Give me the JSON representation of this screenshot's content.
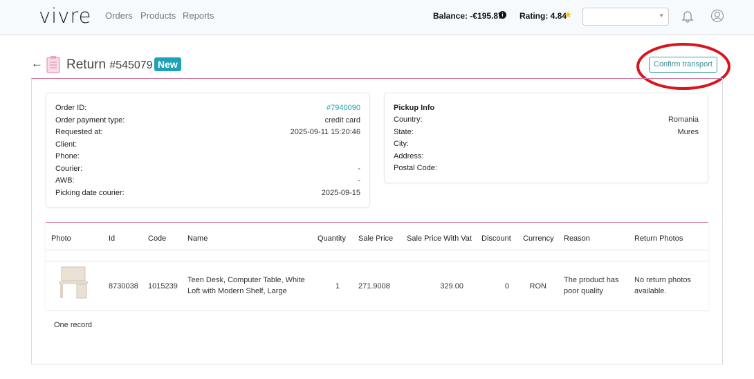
{
  "nav": {
    "logo": "vivre",
    "links": [
      "Orders",
      "Products",
      "Reports"
    ],
    "balance": "Balance: -€195.87",
    "rating": "Rating: 4.84",
    "select_value": ""
  },
  "header": {
    "title": "Return",
    "number": "#545079",
    "status": "New",
    "confirm_label": "Confirm transport"
  },
  "order": {
    "rows": [
      {
        "label": "Order ID:",
        "value": "#7940090"
      },
      {
        "label": "Order payment type:",
        "value": "credit card"
      },
      {
        "label": "Requested at:",
        "value": "2025-09-11 15:20:46"
      },
      {
        "label": "Client:",
        "value": ""
      },
      {
        "label": "Phone:",
        "value": ""
      },
      {
        "label": "Courier:",
        "value": "-"
      },
      {
        "label": "AWB:",
        "value": "-"
      },
      {
        "label": "Picking date courier:",
        "value": "2025-09-15"
      }
    ]
  },
  "pickup": {
    "title": "Pickup Info",
    "rows": [
      {
        "label": "Country:",
        "value": "Romania"
      },
      {
        "label": "State:",
        "value": "Mures"
      },
      {
        "label": "City:",
        "value": ""
      },
      {
        "label": "Address:",
        "value": ""
      },
      {
        "label": "Postal Code:",
        "value": ""
      }
    ]
  },
  "table": {
    "headers": [
      "Photo",
      "Id",
      "Code",
      "Name",
      "Quantity",
      "Sale Price",
      "Sale Price With Vat",
      "Discount",
      "Currency",
      "Reason",
      "Return Photos"
    ],
    "rows": [
      {
        "id": "8730038",
        "code": "1015239",
        "name": "Teen Desk, Computer Table, White Loft with Modern Shelf, Large",
        "quantity": "1",
        "sale_price": "271.9008",
        "sale_price_vat": "329.00",
        "discount": "0",
        "currency": "RON",
        "reason": "The product has poor quality",
        "return_photos": "No return photos available."
      }
    ],
    "footer": "One record"
  },
  "colors": {
    "accent": "#1fa2b5",
    "divider": "#d37aa0",
    "annotation": "#d9141c"
  }
}
